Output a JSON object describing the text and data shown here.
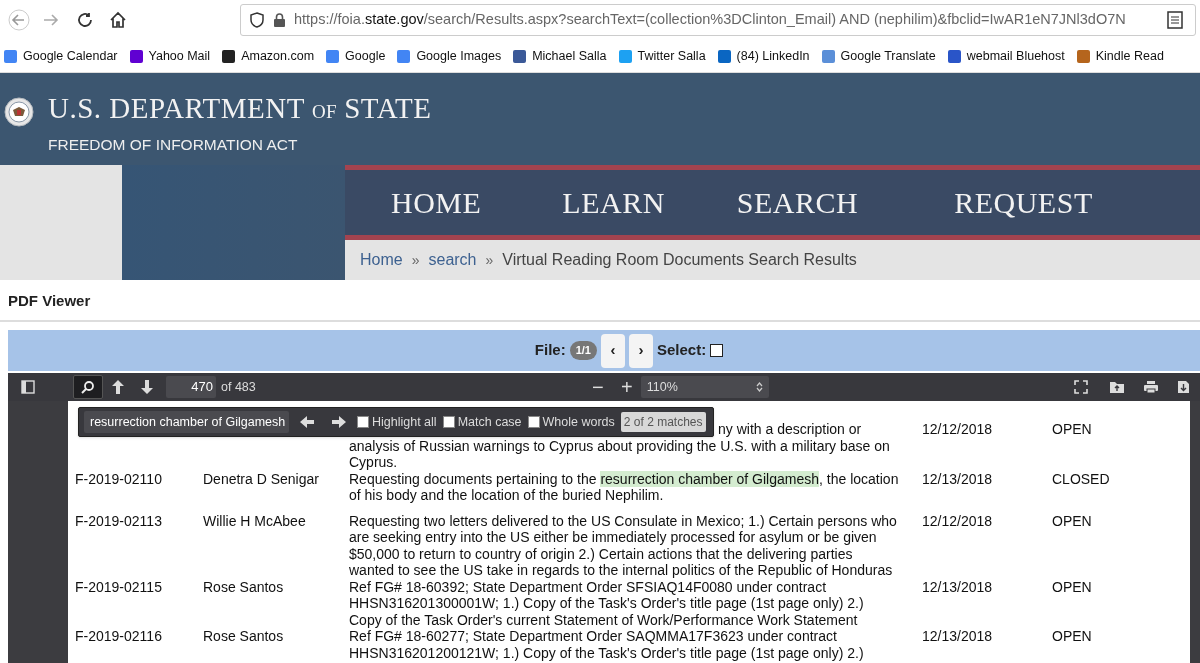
{
  "browser": {
    "url": "https://foia.**state.gov**/search/Results.aspx?searchText=(collection%3DClinton_Email) AND (nephilim)&fbclid=IwAR1eN7JNl3dO7N",
    "bookmarks": [
      {
        "label": "Google Calendar"
      },
      {
        "label": "Yahoo Mail"
      },
      {
        "label": "Amazon.com"
      },
      {
        "label": "Google"
      },
      {
        "label": "Google Images"
      },
      {
        "label": "Michael Salla"
      },
      {
        "label": "Twitter Salla"
      },
      {
        "label": "(84) LinkedIn"
      },
      {
        "label": "Google Translate"
      },
      {
        "label": "webmail Bluehost"
      },
      {
        "label": "Kindle Read"
      }
    ]
  },
  "header": {
    "title_parts": [
      "U.S. DEPARTMENT",
      "OF",
      "STATE"
    ],
    "subtitle": "FREEDOM OF INFORMATION ACT"
  },
  "nav": [
    "HOME",
    "LEARN",
    "SEARCH",
    "REQUEST"
  ],
  "breadcrumb": {
    "separator": "»",
    "items": [
      {
        "label": "Home",
        "kind": "link"
      },
      {
        "label": "search",
        "kind": "link"
      },
      {
        "label": "Virtual Reading Room Documents Search Results",
        "kind": "current"
      }
    ]
  },
  "pdf_viewer": {
    "heading": "PDF Viewer",
    "file_bar": {
      "file_label": "File:",
      "file_count": "1/1",
      "prev": "‹",
      "next": "›",
      "select_label": "Select:",
      "select_checked": false
    },
    "toolbar": {
      "page": "470",
      "page_count": "of 483",
      "zoom_out": "−",
      "zoom_in": "+",
      "zoom": "110%",
      "find_open": true
    },
    "find_bar": {
      "query": "resurrection chamber of Gilgamesh",
      "options": [
        {
          "label": "Highlight all",
          "checked": false
        },
        {
          "label": "Match case",
          "checked": false
        },
        {
          "label": "Whole words",
          "checked": false
        }
      ],
      "result": "2 of 2 matches"
    },
    "rows": [
      {
        "date": "12/12/2018",
        "status": "OPEN",
        "lines": [
          "ny with a description or",
          "analysis of Russian warnings to Cyprus about providing the U.S. with a military base on",
          "Cyprus."
        ]
      },
      {
        "request_number": "F-2019-02110",
        "requester": "Denetra D Senigar",
        "date": "12/13/2018",
        "status": "CLOSED",
        "lines": [
          [
            {
              "text": "Requesting documents pertaining to the ",
              "highlighted": false
            },
            {
              "text": "resurrection chamber of Gilgamesh",
              "highlighted": true
            },
            {
              "text": ", the location",
              "highlighted": false
            }
          ],
          "of his body and the location of the buried Nephilim."
        ]
      },
      {
        "request_number": "F-2019-02113",
        "requester": "Willie H McAbee",
        "date": "12/12/2018",
        "status": "OPEN",
        "lines": [
          "Requesting two letters delivered to the US Consulate in Mexico; 1.) Certain persons who",
          "are seeking entry into the US either be immediately processed for asylum or be given",
          "$50,000 to return to country of origin 2.) Certain actions that the delivering parties",
          "wanted to see the US take in regards to the internal politics of the Republic of Honduras"
        ]
      },
      {
        "request_number": "F-2019-02115",
        "requester": "Rose Santos",
        "date": "12/13/2018",
        "status": "OPEN",
        "lines": [
          "Ref FG# 18-60392; State Department Order SFSIAQ14F0080 under contract",
          "HHSN316201300001W; 1.) Copy of the Task's Order's title page (1st page only) 2.)",
          "Copy of the Task Order's current Statement of Work/Performance Work Statement"
        ]
      },
      {
        "request_number": "F-2019-02116",
        "requester": "Rose Santos",
        "date": "12/13/2018",
        "status": "OPEN",
        "lines": [
          "Ref FG# 18-60277; State Department Order SAQMMA17F3623 under contract",
          "HHSN316201200121W; 1.) Copy of the Task's Order's title page (1st page only) 2.)"
        ]
      }
    ]
  }
}
